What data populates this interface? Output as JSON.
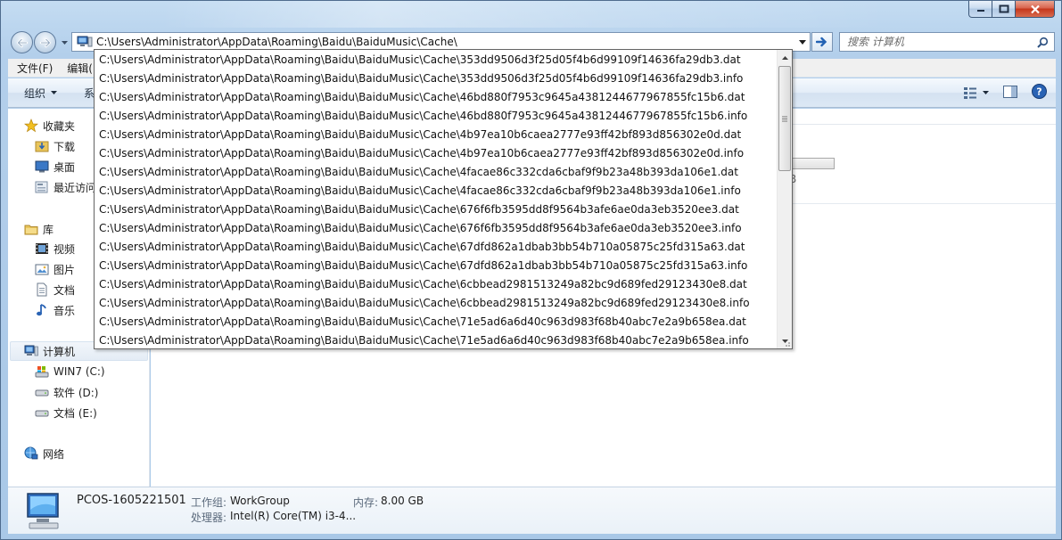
{
  "address": {
    "path": "C:\\Users\\Administrator\\AppData\\Roaming\\Baidu\\BaiduMusic\\Cache\\"
  },
  "search": {
    "placeholder": "搜索 计算机"
  },
  "menu": [
    "文件(F)",
    "编辑(E)"
  ],
  "toolbar": {
    "organize": "组织",
    "second_fragment": "系"
  },
  "nav": {
    "favorites": "收藏夹",
    "downloads": "下载",
    "desktop": "桌面",
    "recent": "最近访问",
    "libraries": "库",
    "videos": "视频",
    "pictures": "图片",
    "documents": "文档",
    "music": "音乐",
    "computer": "计算机",
    "drive_c": "WIN7 (C:)",
    "drive_d": "软件 (D:)",
    "drive_e": "文档 (E:)",
    "network": "网络"
  },
  "content": {
    "fragment": "B"
  },
  "details": {
    "computer_name": "PCOS-1605221501",
    "workgroup_label": "工作组:",
    "workgroup_value": "WorkGroup",
    "memory_label": "内存:",
    "memory_value": "8.00 GB",
    "processor_label": "处理器:",
    "processor_value": "Intel(R) Core(TM) i3-4..."
  },
  "autocomplete": [
    "C:\\Users\\Administrator\\AppData\\Roaming\\Baidu\\BaiduMusic\\Cache\\353dd9506d3f25d05f4b6d99109f14636fa29db3.dat",
    "C:\\Users\\Administrator\\AppData\\Roaming\\Baidu\\BaiduMusic\\Cache\\353dd9506d3f25d05f4b6d99109f14636fa29db3.info",
    "C:\\Users\\Administrator\\AppData\\Roaming\\Baidu\\BaiduMusic\\Cache\\46bd880f7953c9645a4381244677967855fc15b6.dat",
    "C:\\Users\\Administrator\\AppData\\Roaming\\Baidu\\BaiduMusic\\Cache\\46bd880f7953c9645a4381244677967855fc15b6.info",
    "C:\\Users\\Administrator\\AppData\\Roaming\\Baidu\\BaiduMusic\\Cache\\4b97ea10b6caea2777e93ff42bf893d856302e0d.dat",
    "C:\\Users\\Administrator\\AppData\\Roaming\\Baidu\\BaiduMusic\\Cache\\4b97ea10b6caea2777e93ff42bf893d856302e0d.info",
    "C:\\Users\\Administrator\\AppData\\Roaming\\Baidu\\BaiduMusic\\Cache\\4facae86c332cda6cbaf9f9b23a48b393da106e1.dat",
    "C:\\Users\\Administrator\\AppData\\Roaming\\Baidu\\BaiduMusic\\Cache\\4facae86c332cda6cbaf9f9b23a48b393da106e1.info",
    "C:\\Users\\Administrator\\AppData\\Roaming\\Baidu\\BaiduMusic\\Cache\\676f6fb3595dd8f9564b3afe6ae0da3eb3520ee3.dat",
    "C:\\Users\\Administrator\\AppData\\Roaming\\Baidu\\BaiduMusic\\Cache\\676f6fb3595dd8f9564b3afe6ae0da3eb3520ee3.info",
    "C:\\Users\\Administrator\\AppData\\Roaming\\Baidu\\BaiduMusic\\Cache\\67dfd862a1dbab3bb54b710a05875c25fd315a63.dat",
    "C:\\Users\\Administrator\\AppData\\Roaming\\Baidu\\BaiduMusic\\Cache\\67dfd862a1dbab3bb54b710a05875c25fd315a63.info",
    "C:\\Users\\Administrator\\AppData\\Roaming\\Baidu\\BaiduMusic\\Cache\\6cbbead2981513249a82bc9d689fed29123430e8.dat",
    "C:\\Users\\Administrator\\AppData\\Roaming\\Baidu\\BaiduMusic\\Cache\\6cbbead2981513249a82bc9d689fed29123430e8.info",
    "C:\\Users\\Administrator\\AppData\\Roaming\\Baidu\\BaiduMusic\\Cache\\71e5ad6a6d40c963d983f68b40abc7e2a9b658ea.dat",
    "C:\\Users\\Administrator\\AppData\\Roaming\\Baidu\\BaiduMusic\\Cache\\71e5ad6a6d40c963d983f68b40abc7e2a9b658ea.info"
  ],
  "icons": {
    "back": "back-arrow-icon",
    "forward": "forward-arrow-icon",
    "go": "go-arrow-icon",
    "search": "search-icon",
    "help": "help-icon",
    "view": "view-options-icon",
    "preview_pane": "preview-pane-icon"
  },
  "colors": {
    "accent": "#1e5aa8",
    "close": "#c5371c",
    "frame": "#b3cfeb"
  }
}
